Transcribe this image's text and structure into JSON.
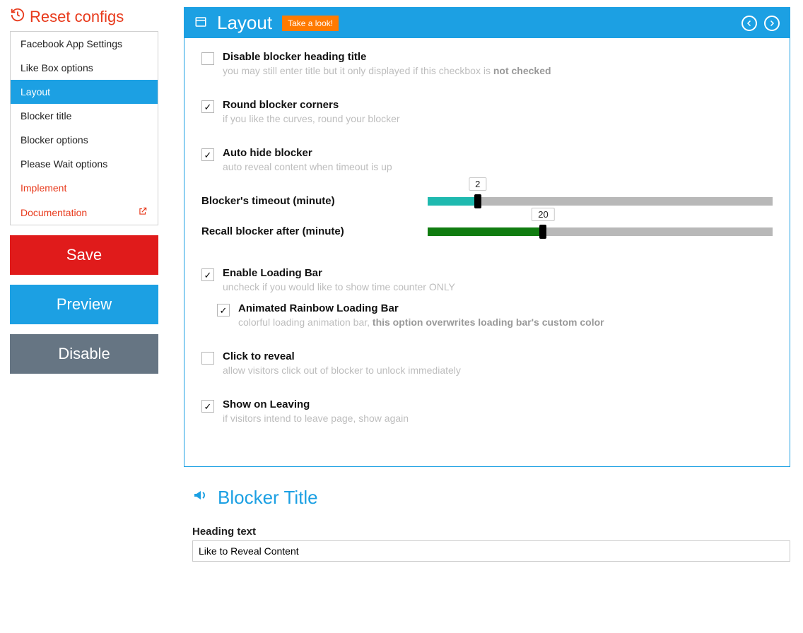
{
  "reset_label": "Reset configs",
  "nav": {
    "items": [
      {
        "label": "Facebook App Settings",
        "active": false,
        "accent": false
      },
      {
        "label": "Like Box options",
        "active": false,
        "accent": false
      },
      {
        "label": "Layout",
        "active": true,
        "accent": false
      },
      {
        "label": "Blocker title",
        "active": false,
        "accent": false
      },
      {
        "label": "Blocker options",
        "active": false,
        "accent": false
      },
      {
        "label": "Please Wait options",
        "active": false,
        "accent": false
      },
      {
        "label": "Implement",
        "active": false,
        "accent": true
      },
      {
        "label": "Documentation",
        "active": false,
        "accent": true,
        "external": true
      }
    ]
  },
  "buttons": {
    "save": "Save",
    "preview": "Preview",
    "disable": "Disable"
  },
  "panel": {
    "icon": "window-icon",
    "title": "Layout",
    "chip": "Take a look!",
    "fields": [
      {
        "id": "disable-heading",
        "checked": false,
        "label": "Disable blocker heading title",
        "desc": "you may still enter title but it only displayed if this checkbox is",
        "desc_bold": "not checked"
      },
      {
        "id": "round-corners",
        "checked": true,
        "label": "Round blocker corners",
        "desc": "if you like the curves, round your blocker"
      },
      {
        "id": "auto-hide",
        "checked": true,
        "label": "Auto hide blocker",
        "desc": "auto reveal content when timeout is up"
      }
    ],
    "sliders": [
      {
        "id": "timeout",
        "label": "Blocker's timeout (minute)",
        "value": 2,
        "percent": 14.5,
        "color": "#1fb9af"
      },
      {
        "id": "recall",
        "label": "Recall blocker after (minute)",
        "value": 20,
        "percent": 33.5,
        "color": "#107c10"
      }
    ],
    "fields2": [
      {
        "id": "enable-loading",
        "checked": true,
        "label": "Enable Loading Bar",
        "desc": "uncheck if you would like to show time counter ONLY"
      },
      {
        "id": "rainbow",
        "checked": true,
        "sub": true,
        "label": "Animated Rainbow Loading Bar",
        "desc": "colorful loading animation bar,",
        "desc_bold": "this option overwrites loading bar's custom color"
      },
      {
        "id": "click-reveal",
        "checked": false,
        "label": "Click to reveal",
        "desc": "allow visitors click out of blocker to unlock immediately"
      },
      {
        "id": "show-leaving",
        "checked": true,
        "label": "Show on Leaving",
        "desc": "if visitors intend to leave page, show again"
      }
    ]
  },
  "section2": {
    "title": "Blocker Title",
    "field_label": "Heading text",
    "field_value": "Like to Reveal Content"
  }
}
